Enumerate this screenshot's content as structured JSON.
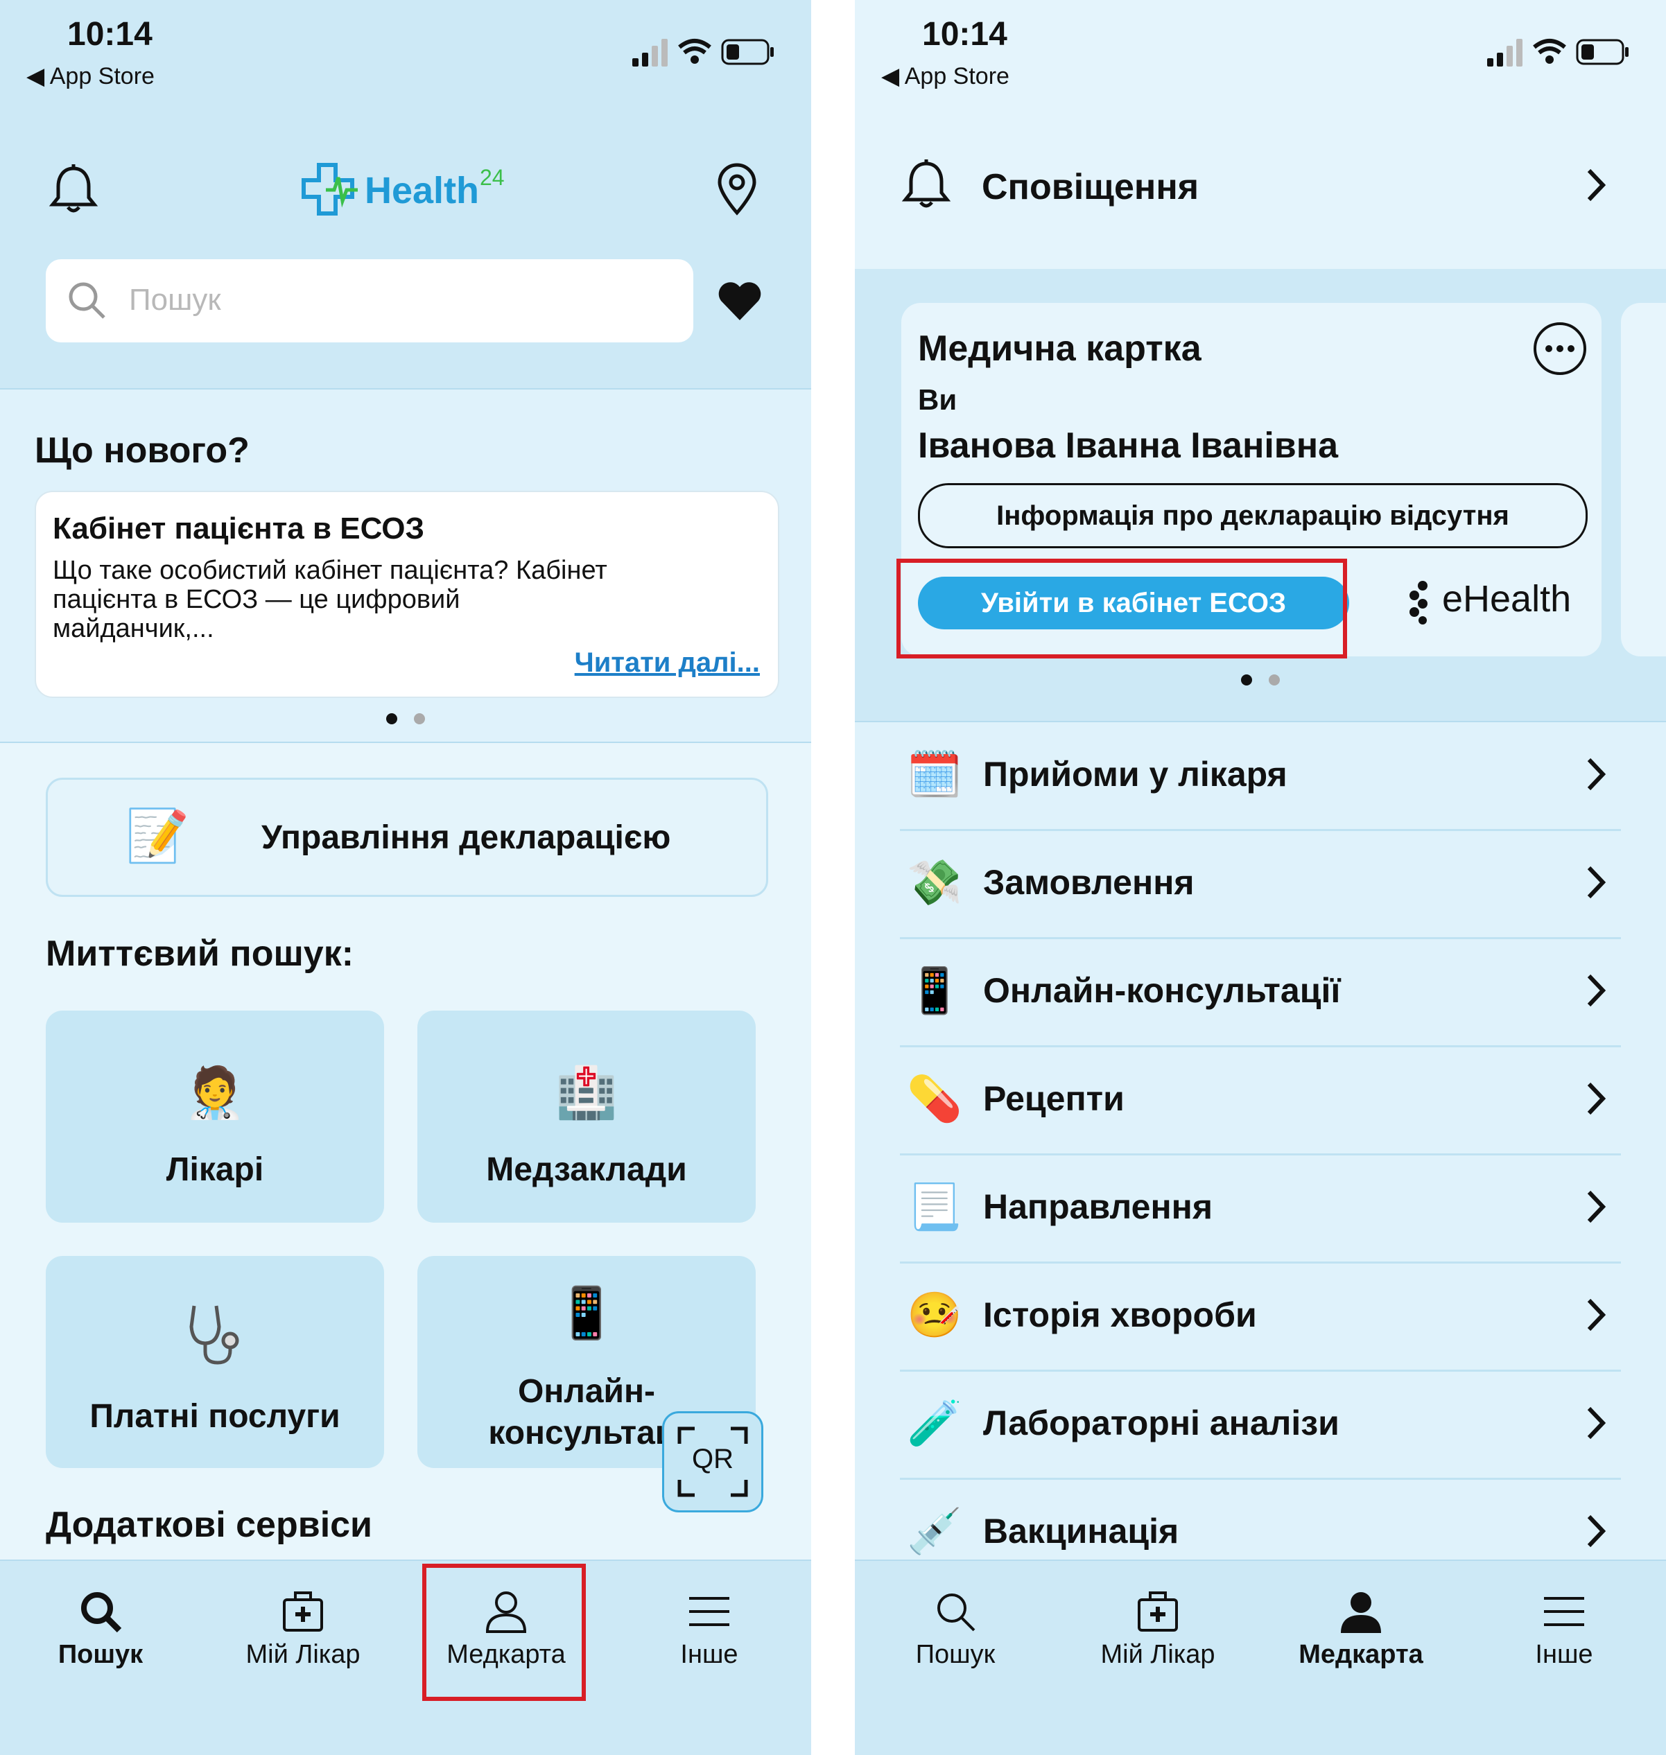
{
  "status": {
    "time": "10:14",
    "back_label": "App Store"
  },
  "left": {
    "brand": {
      "name": "Health",
      "superscript": "24"
    },
    "search": {
      "placeholder": "Пошук"
    },
    "news": {
      "title": "Що нового?",
      "card_title": "Кабінет пацієнта в ЕСОЗ",
      "card_body": "Що таке особистий кабінет пацієнта? Кабінет пацієнта в ЕСОЗ — це цифровий майданчик,...",
      "read_more": "Читати далі..."
    },
    "declaration_button": "Управління декларацією",
    "quick_search": {
      "title": "Миттєвий пошук:",
      "tiles": [
        {
          "label": "Лікарі",
          "icon": "doctor-icon"
        },
        {
          "label": "Медзаклади",
          "icon": "hospital-icon"
        },
        {
          "label": "Платні послуги",
          "icon": "stethoscope-icon"
        },
        {
          "label": "Онлайн-консультаці",
          "label_line1": "Онлайн-",
          "label_line2": "консультаці",
          "icon": "mobile-phone-icon"
        }
      ]
    },
    "qr_label": "QR",
    "extra_services_title": "Додаткові сервіси",
    "nav": [
      {
        "label": "Пошук",
        "icon": "search-icon",
        "active": true
      },
      {
        "label": "Мій Лікар",
        "icon": "medkit-icon",
        "active": false
      },
      {
        "label": "Медкарта",
        "icon": "user-icon",
        "active": false
      },
      {
        "label": "Інше",
        "icon": "menu-icon",
        "active": false
      }
    ]
  },
  "right": {
    "notifications_label": "Сповіщення",
    "med_card": {
      "title": "Медична картка",
      "subtitle": "Ви",
      "patient_name": "Іванова Іванна Іванівна",
      "declaration_status": "Інформація про декларацію відсутня",
      "login_button": "Увійти в кабінет ЕСОЗ",
      "partner_logo": "eHealth"
    },
    "menu": [
      {
        "label": "Прийоми у лікаря",
        "icon": "calendar-icon"
      },
      {
        "label": "Замовлення",
        "icon": "money-icon"
      },
      {
        "label": "Онлайн-консультації",
        "icon": "mobile-phone-icon"
      },
      {
        "label": "Рецепти",
        "icon": "pill-icon"
      },
      {
        "label": "Направлення",
        "icon": "document-icon"
      },
      {
        "label": "Історія хвороби",
        "icon": "sick-face-icon"
      },
      {
        "label": "Лабораторні аналізи",
        "icon": "test-tube-icon"
      },
      {
        "label": "Вакцинація",
        "icon": "syringe-icon"
      }
    ],
    "nav": [
      {
        "label": "Пошук",
        "icon": "search-icon",
        "active": false
      },
      {
        "label": "Мій Лікар",
        "icon": "medkit-icon",
        "active": false
      },
      {
        "label": "Медкарта",
        "icon": "user-icon",
        "active": true
      },
      {
        "label": "Інше",
        "icon": "menu-icon",
        "active": false
      }
    ]
  },
  "colors": {
    "accent_blue": "#2aa8e4",
    "highlight_red": "#d81e26",
    "brand_green": "#3bbf4a",
    "link_blue": "#1d7fc8"
  }
}
